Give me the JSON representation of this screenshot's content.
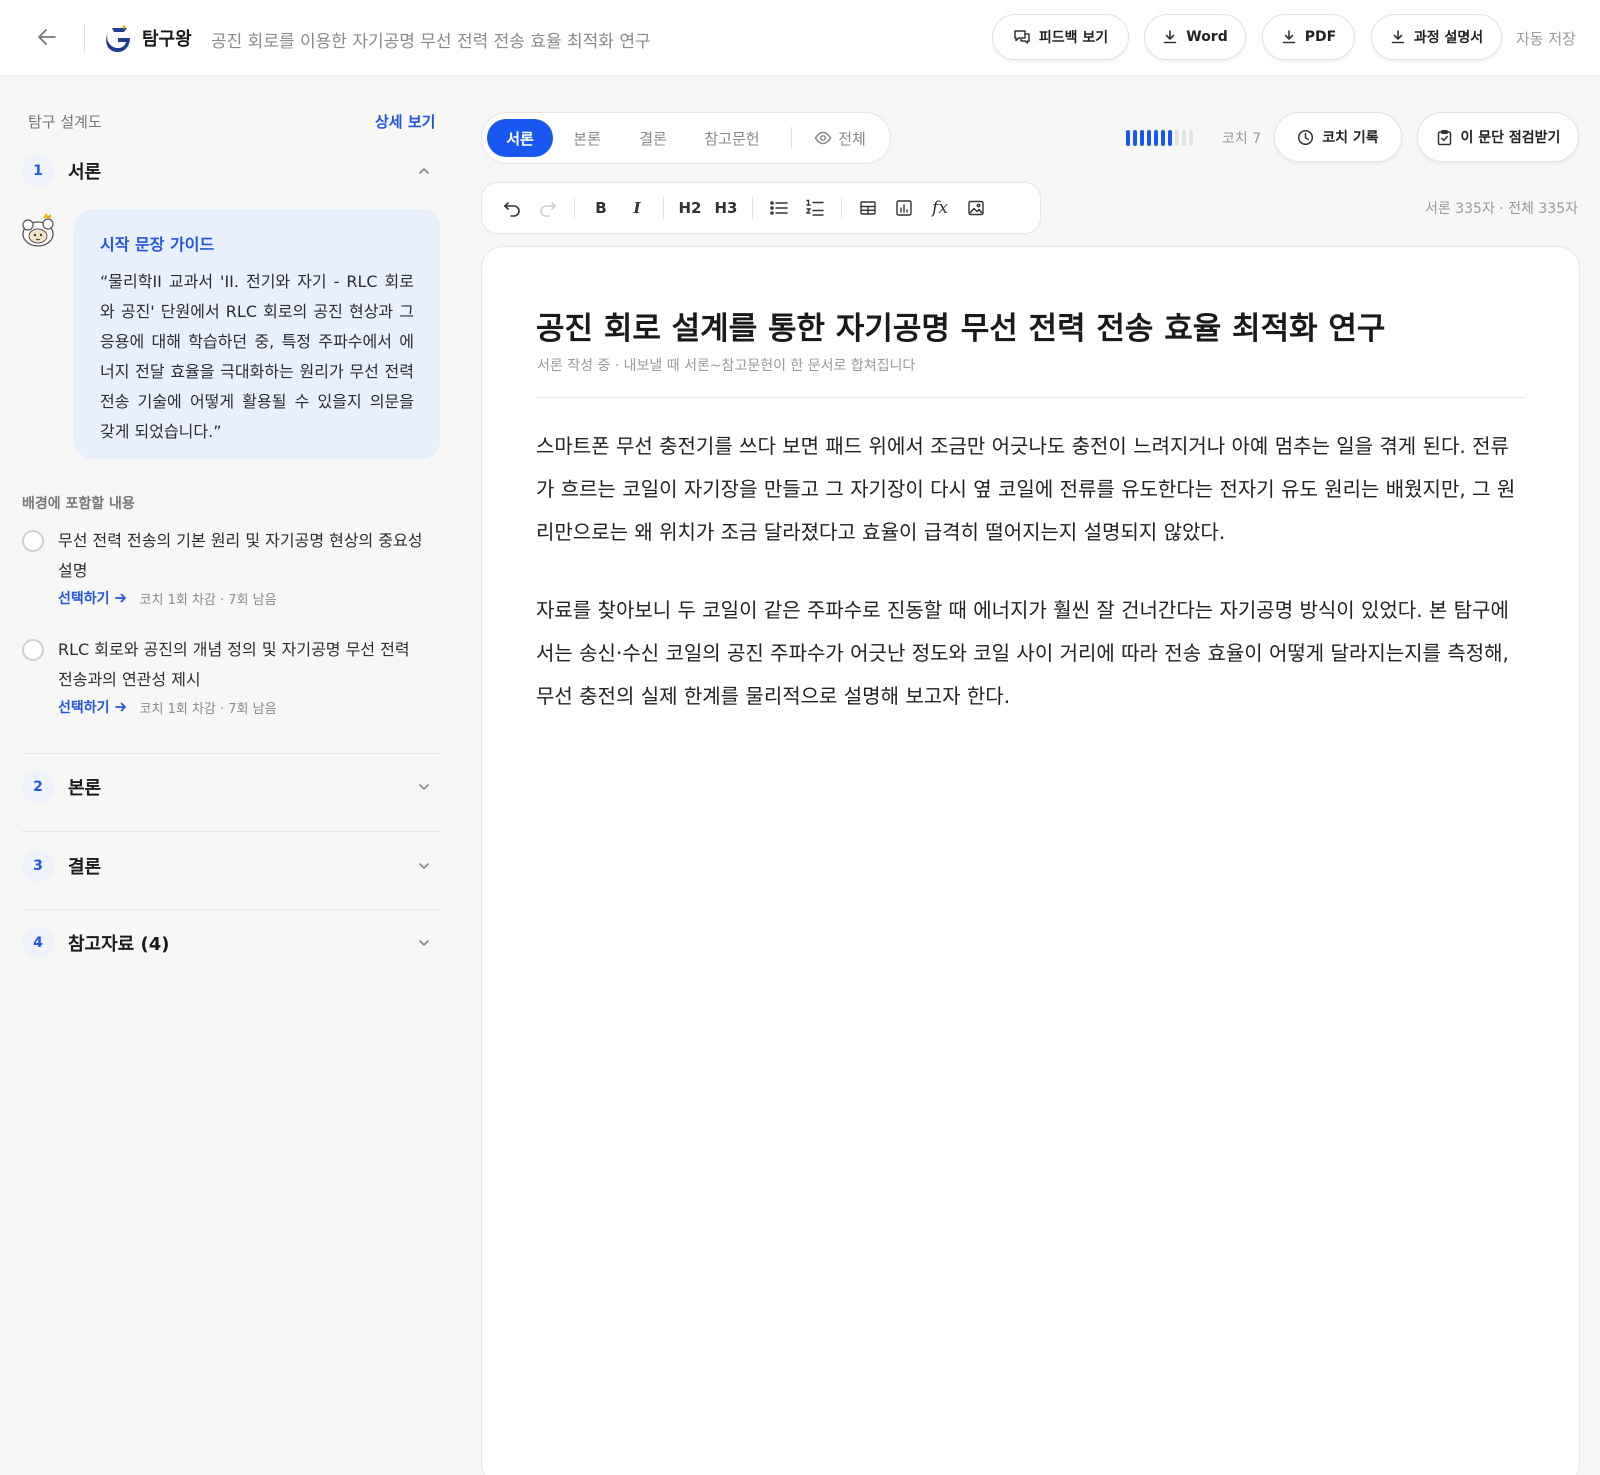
{
  "header": {
    "brand": "탐구왕",
    "doc_title": "공진 회로를 이용한 자기공명 무선 전력 전송 효율 최적화 연구",
    "feedback_label": "피드백 보기",
    "word_label": "Word",
    "pdf_label": "PDF",
    "process_label": "과정 설명서",
    "autosave_label": "자동 저장"
  },
  "sidebar": {
    "title": "탐구 설계도",
    "detail_link": "상세 보기",
    "sections": [
      {
        "num": "1",
        "label": "서론",
        "expanded": true
      },
      {
        "num": "2",
        "label": "본론",
        "expanded": false
      },
      {
        "num": "3",
        "label": "결론",
        "expanded": false
      },
      {
        "num": "4",
        "label": "참고자료 (4)",
        "expanded": false
      }
    ],
    "guide": {
      "title": "시작 문장 가이드",
      "text": "“물리학II 교과서 'II. 전기와 자기 - RLC 회로와 공진' 단원에서 RLC 회로의 공진 현상과 그 응용에 대해 학습하던 중, 특정 주파수에서 에너지 전달 효율을 극대화하는 원리가 무선 전력 전송 기술에 어떻게 활용될 수 있을지 의문을 갖게 되었습니다.”"
    },
    "background_label": "배경에 포함할 내용",
    "checklist": [
      {
        "text": "무선 전력 전송의 기본 원리 및 자기공명 현상의 중요성 설명",
        "action": "선택하기",
        "hint": "코치 1회 차감 · 7회 남음"
      },
      {
        "text": "RLC 회로와 공진의 개념 정의 및 자기공명 무선 전력 전송과의 연관성 제시",
        "action": "선택하기",
        "hint": "코치 1회 차감 · 7회 남음"
      }
    ]
  },
  "tabs": [
    {
      "label": "서론",
      "active": true
    },
    {
      "label": "본론",
      "active": false
    },
    {
      "label": "결론",
      "active": false
    },
    {
      "label": "참고문헌",
      "active": false
    },
    {
      "label": "전체",
      "active": false
    }
  ],
  "coach": {
    "remaining_label": "코치 7",
    "progress_filled": 7,
    "progress_total": 10,
    "log_label": "코치 기록",
    "check_label": "이 문단 점검받기"
  },
  "toolbar": {
    "h2": "H2",
    "h3": "H3",
    "bold": "B",
    "italic": "I",
    "fx": "fx"
  },
  "char_count": "서론 335자 · 전체 335자",
  "editor": {
    "title": "공진 회로 설계를 통한 자기공명 무선 전력 전송 효율 최적화 연구",
    "subtitle": "서론 작성 중 · 내보낼 때 서론~참고문헌이 한 문서로 합쳐집니다",
    "paragraphs": [
      "스마트폰 무선 충전기를 쓰다 보면 패드 위에서 조금만 어긋나도 충전이 느려지거나 아예 멈추는 일을 겪게 된다. 전류가 흐르는 코일이 자기장을 만들고 그 자기장이 다시 옆 코일에 전류를 유도한다는 전자기 유도 원리는 배웠지만, 그 원리만으로는 왜 위치가 조금 달라졌다고 효율이 급격히 떨어지는지 설명되지 않았다.",
      "자료를 찾아보니 두 코일이 같은 주파수로 진동할 때 에너지가 훨씬 잘 건너간다는 자기공명 방식이 있었다. 본 탐구에서는 송신·수신 코일의 공진 주파수가 어긋난 정도와 코일 사이 거리에 따라 전송 효율이 어떻게 달라지는지를 측정해, 무선 충전의 실제 한계를 물리적으로 설명해 보고자 한다."
    ]
  },
  "colors": {
    "accent": "#1a56f0",
    "link": "#2255e0",
    "guide_bg": "#e8effd"
  }
}
